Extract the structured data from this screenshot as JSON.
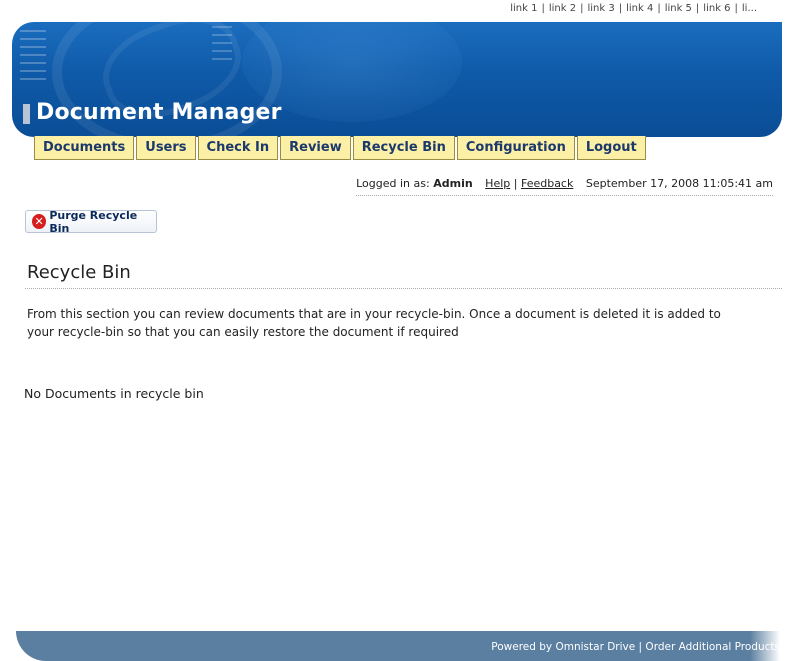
{
  "toplinks": [
    "link 1",
    "link 2",
    "link 3",
    "link 4",
    "link 5",
    "link 6",
    "li..."
  ],
  "header": {
    "title": "Document Manager"
  },
  "nav": [
    {
      "label": "Documents"
    },
    {
      "label": "Users"
    },
    {
      "label": "Check In"
    },
    {
      "label": "Review"
    },
    {
      "label": "Recycle Bin"
    },
    {
      "label": "Configuration"
    },
    {
      "label": "Logout"
    }
  ],
  "status": {
    "logged_in_label": "Logged in as:",
    "user": "Admin",
    "help": "Help",
    "feedback": "Feedback",
    "datetime": "September 17, 2008 11:05:41 am"
  },
  "actions": {
    "purge_label": "Purge Recycle Bin"
  },
  "page": {
    "title": "Recycle Bin",
    "description": "From this section you can review documents that are in your recycle-bin. Once a document is deleted it is added to your recycle-bin so that you can easily restore the document if required",
    "empty_message": "No Documents in recycle bin"
  },
  "footer": {
    "text": "Powered by Omnistar Drive | Order Additional Products"
  },
  "colors": {
    "header_blue": "#0f5aa8",
    "tab_yellow": "#fcefa6",
    "footer_blue": "#5b7fa1",
    "purge_red": "#d51f1f"
  }
}
